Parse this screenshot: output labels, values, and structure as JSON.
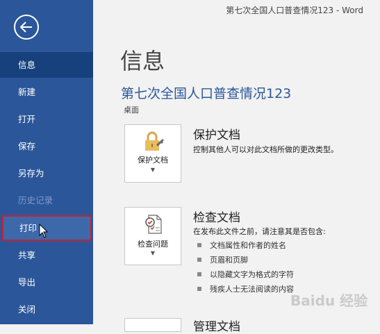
{
  "window": {
    "title": "第七次全国人口普查情况123  -  Word"
  },
  "sidebar": {
    "items": [
      {
        "label": "信息"
      },
      {
        "label": "新建"
      },
      {
        "label": "打开"
      },
      {
        "label": "保存"
      },
      {
        "label": "另存为"
      },
      {
        "label": "历史记录"
      },
      {
        "label": "打印"
      },
      {
        "label": "共享"
      },
      {
        "label": "导出"
      },
      {
        "label": "关闭"
      }
    ]
  },
  "main": {
    "heading": "信息",
    "doc_title": "第七次全国人口普查情况123",
    "doc_location": "桌面",
    "protect": {
      "button_label": "保护文档",
      "title": "保护文档",
      "description": "控制其他人可以对此文档所做的更改类型。"
    },
    "inspect": {
      "button_label": "检查问题",
      "title": "检查文档",
      "description": "在发布此文件之前，请注意其是否包含:",
      "bullets": [
        "文档属性和作者的姓名",
        "页眉和页脚",
        "以隐藏文字为格式的字符",
        "残疾人士无法阅读的内容"
      ]
    },
    "manage": {
      "title": "管理文档"
    }
  },
  "watermark": {
    "text": "Baidu 经验"
  },
  "colors": {
    "sidebar": "#2b579a",
    "selected": "#16417c",
    "highlight_border": "#c8202f",
    "accent_text": "#2b579a"
  }
}
